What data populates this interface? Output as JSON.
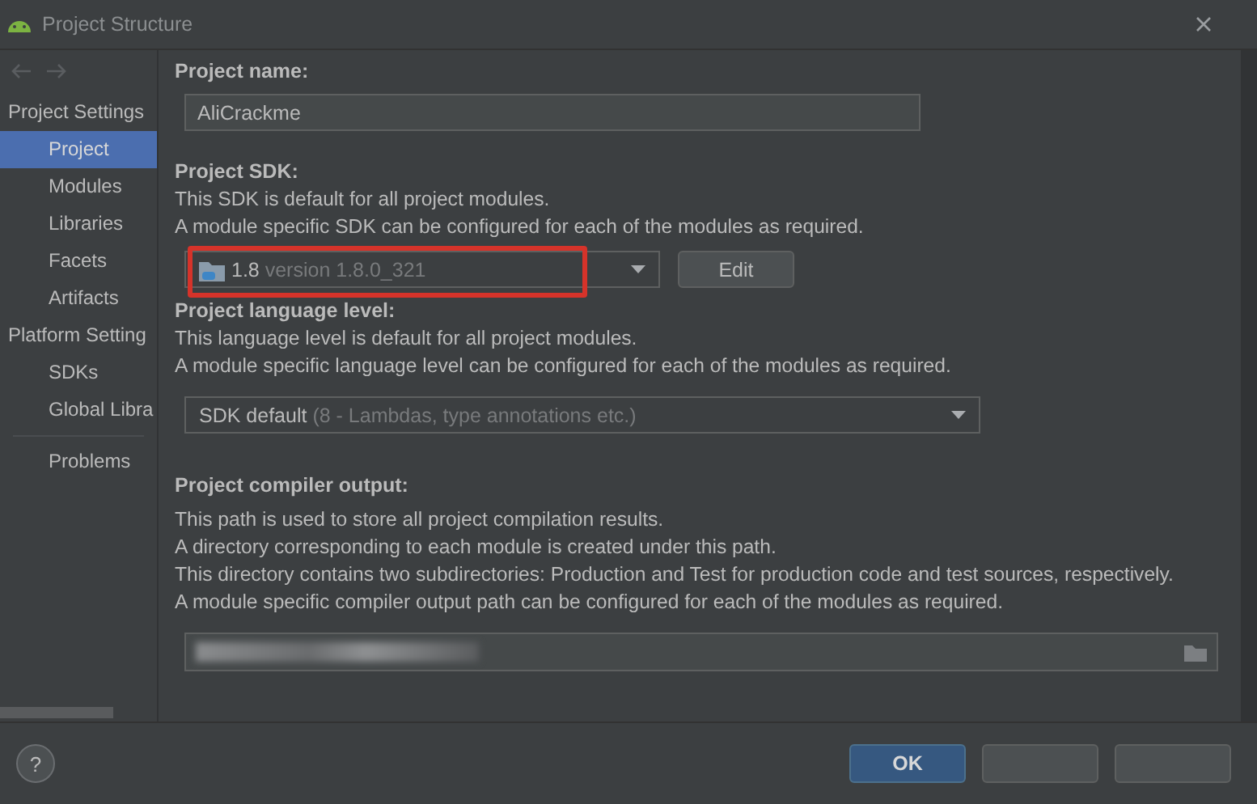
{
  "window": {
    "title": "Project Structure"
  },
  "sidebar": {
    "sections": [
      {
        "title": "Project Settings",
        "items": [
          {
            "label": "Project",
            "selected": true
          },
          {
            "label": "Modules",
            "selected": false
          },
          {
            "label": "Libraries",
            "selected": false
          },
          {
            "label": "Facets",
            "selected": false
          },
          {
            "label": "Artifacts",
            "selected": false
          }
        ]
      },
      {
        "title": "Platform Setting",
        "items": [
          {
            "label": "SDKs",
            "selected": false
          },
          {
            "label": "Global Libra",
            "selected": false
          }
        ]
      }
    ],
    "extra_items": [
      {
        "label": "Problems",
        "selected": false
      }
    ]
  },
  "project_name": {
    "label": "Project name:",
    "value": "AliCrackme"
  },
  "project_sdk": {
    "label": "Project SDK:",
    "lines": [
      "This SDK is default for all project modules.",
      "A module specific SDK can be configured for each of the modules as required."
    ],
    "dropdown": {
      "value": "1.8",
      "hint": "version 1.8.0_321",
      "highlighted": true
    },
    "edit_button": "Edit"
  },
  "language_level": {
    "label": "Project language level:",
    "lines": [
      "This language level is default for all project modules.",
      "A module specific language level can be configured for each of the modules as required."
    ],
    "dropdown": {
      "value": "SDK default",
      "hint": "(8 - Lambdas, type annotations etc.)"
    }
  },
  "compiler_output": {
    "label": "Project compiler output:",
    "lines": [
      "This path is used to store all project compilation results.",
      "A directory corresponding to each module is created under this path.",
      "This directory contains two subdirectories: Production and Test for production code and test sources, respectively.",
      "A module specific compiler output path can be configured for each of the modules as required."
    ]
  },
  "help_button": "?",
  "buttons": [
    {
      "label": "OK",
      "kind": "primary"
    },
    {
      "kind": "secondary"
    },
    {
      "kind": "secondary"
    }
  ]
}
